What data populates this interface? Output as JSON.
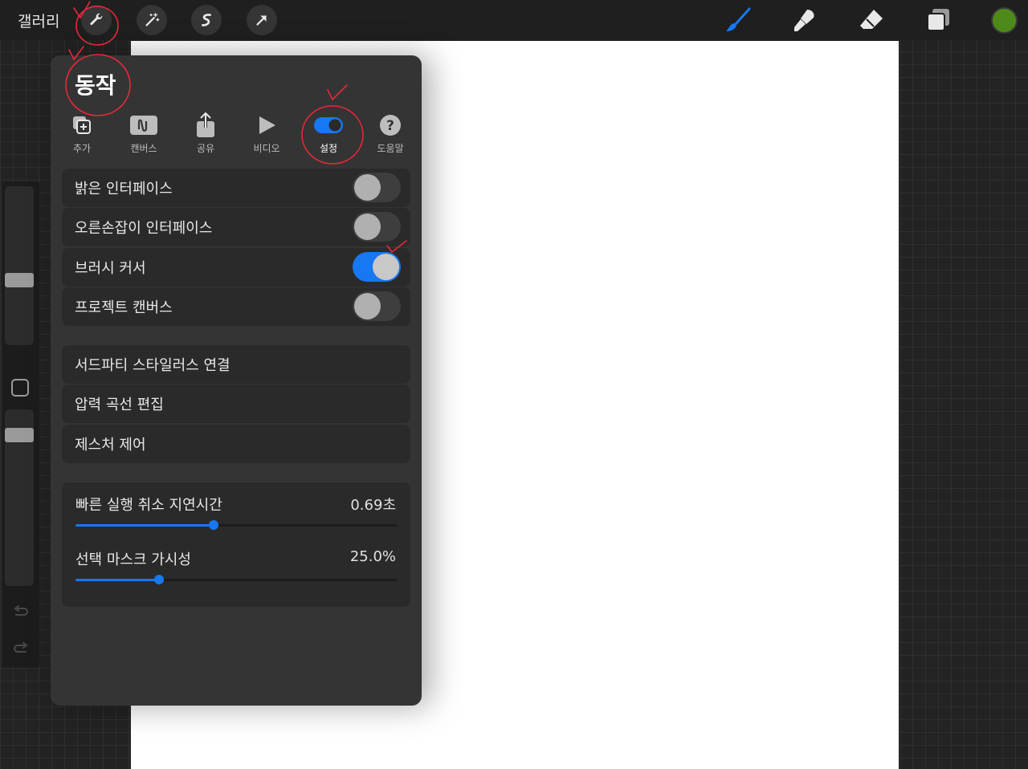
{
  "topbar": {
    "gallery_label": "갤러리",
    "tools": [
      "wrench-icon",
      "magic-wand-icon",
      "selection-icon",
      "transform-arrow-icon"
    ],
    "right_tools": [
      "brush-icon",
      "smudge-icon",
      "eraser-icon",
      "layers-icon"
    ],
    "current_color": "#4e8a1a",
    "active_tool_color": "#1877f2"
  },
  "panel": {
    "title": "동작",
    "tabs": [
      {
        "label": "추가",
        "icon": "add-image-icon"
      },
      {
        "label": "캔버스",
        "icon": "canvas-icon"
      },
      {
        "label": "공유",
        "icon": "share-icon"
      },
      {
        "label": "비디오",
        "icon": "play-icon"
      },
      {
        "label": "설정",
        "icon": "toggle-icon",
        "active": true
      },
      {
        "label": "도움말",
        "icon": "help-icon"
      }
    ],
    "toggles": [
      {
        "label": "밝은 인터페이스",
        "on": false
      },
      {
        "label": "오른손잡이 인터페이스",
        "on": false
      },
      {
        "label": "브러시 커서",
        "on": true
      },
      {
        "label": "프로젝트 캔버스",
        "on": false
      }
    ],
    "links": [
      {
        "label": "서드파티 스타일러스 연결"
      },
      {
        "label": "압력 곡선 편집"
      },
      {
        "label": "제스처 제어"
      }
    ],
    "sliders": [
      {
        "label": "빠른 실행 취소 지연시간",
        "value_text": "0.69초",
        "fraction": 0.43
      },
      {
        "label": "선택 마스크 가시성",
        "value_text": "25.0%",
        "fraction": 0.26
      }
    ]
  },
  "sidebar": {
    "brush_size_fraction": 0.6,
    "opacity_fraction": 0.95
  }
}
